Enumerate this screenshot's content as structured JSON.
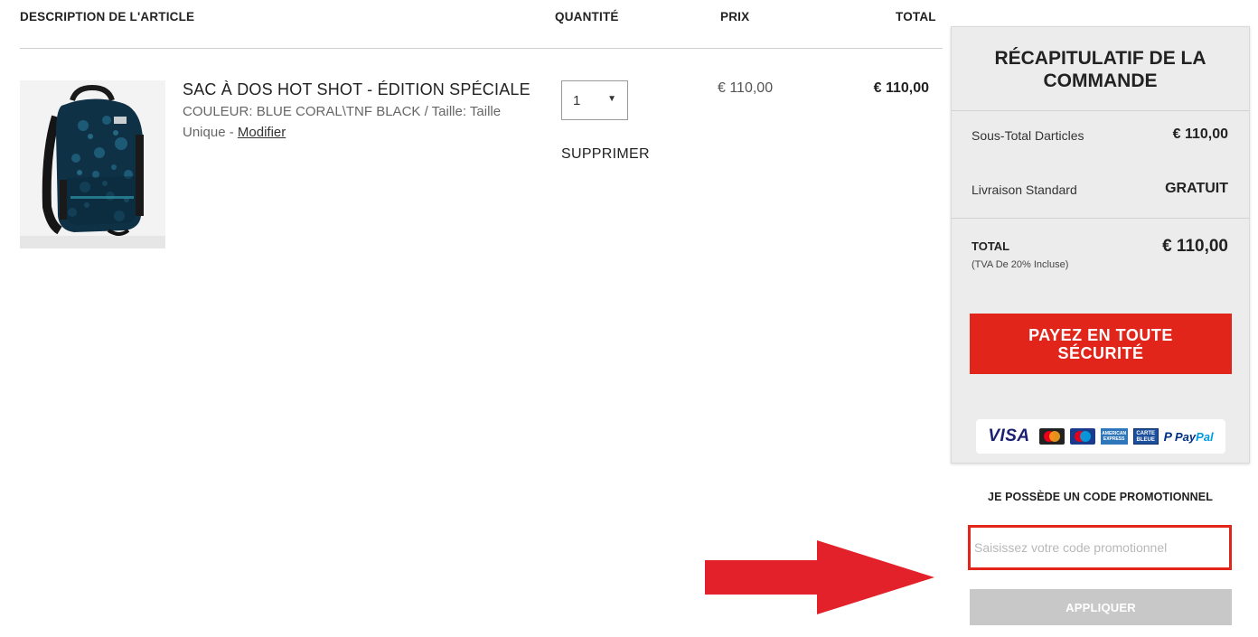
{
  "table": {
    "headers": {
      "description": "DESCRIPTION DE L'ARTICLE",
      "quantity": "QUANTITÉ",
      "price": "PRIX",
      "total": "TOTAL"
    }
  },
  "item": {
    "title": "SAC À DOS HOT SHOT - ÉDITION SPÉCIALE",
    "color_label": "COULEUR:",
    "color_value": "BLUE CORAL\\TNF BLACK",
    "size_label": "Taille:",
    "size_value": "Taille Unique",
    "modify_link": "Modifier",
    "quantity": "1",
    "remove_label": "SUPPRIMER",
    "price": "€ 110,00",
    "total": "€ 110,00",
    "image_icon": "backpack-icon"
  },
  "summary": {
    "title_line1": "RÉCAPITULATIF DE LA",
    "title_line2": "COMMANDE",
    "subtotal_label": "Sous-Total Darticles",
    "subtotal_value": "€ 110,00",
    "shipping_label": "Livraison Standard",
    "shipping_value": "GRATUIT",
    "total_label": "TOTAL",
    "tax_note": "(TVA De 20% Incluse)",
    "total_value": "€ 110,00",
    "pay_line1": "PAYEZ EN TOUTE",
    "pay_line2": "SÉCURITÉ",
    "payment_methods": {
      "visa": "VISA",
      "amex": "AMERICAN EXPRESS",
      "cb": "CARTE BLEUE",
      "paypal_1": "Pay",
      "paypal_2": "Pal"
    }
  },
  "promo": {
    "title": "JE POSSÈDE UN CODE PROMOTIONNEL",
    "placeholder": "Saisissez votre code promotionnel",
    "value": "",
    "apply_label": "APPLIQUER"
  },
  "colors": {
    "accent_red": "#e1251b",
    "panel_bg": "#ececec",
    "disabled_button": "#c8c8c8",
    "annotation_arrow": "#e3212a"
  }
}
